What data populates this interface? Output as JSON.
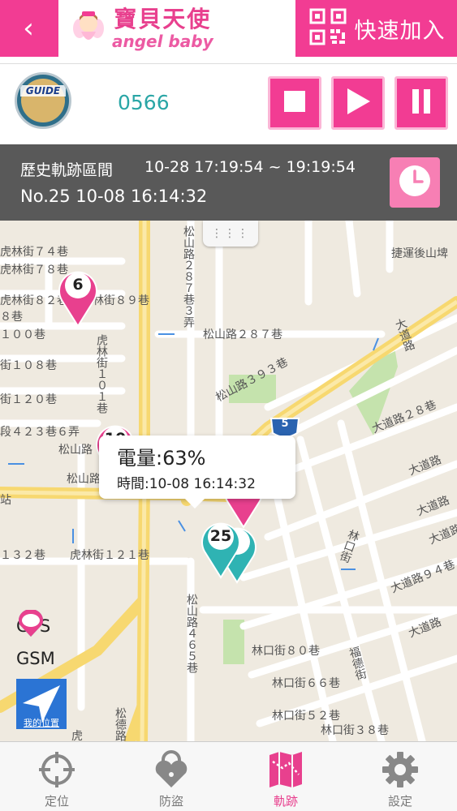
{
  "header": {
    "back_icon": "chevron-left-icon",
    "brand_cn": "寶貝天使",
    "brand_en": "angel baby",
    "quick_add_label": "快速加入",
    "quick_add_icon": "qr-code-icon",
    "accent_color": "#f23c93"
  },
  "device": {
    "logo_text": "GUIDE",
    "id": "0566",
    "controls": [
      "stop-icon",
      "play-icon",
      "pause-icon"
    ]
  },
  "history": {
    "title": "歷史軌跡區間",
    "range": "10-28 17:19:54 ~ 19:19:54",
    "record": "No.25 10-08 16:14:32",
    "clock_icon": "clock-icon"
  },
  "map": {
    "streets": [
      "虎林街７４巷",
      "虎林街７８巷",
      "虎林街８２巷",
      "８巷",
      "虎林街８９巷",
      "１００巷",
      "街１０８巷",
      "街１２０巷",
      "段４２３巷６弄",
      "松山路",
      "松山路",
      "站",
      "１３２巷",
      "虎林街１２１巷",
      "松山路２８７巷",
      "松山路３９３巷",
      "捷運後山埤",
      "大道路",
      "大道路２８巷",
      "大道路",
      "大道路",
      "大道路",
      "大道路９４巷",
      "大道路",
      "林口街８０巷",
      "林口街６６巷",
      "林口街５２巷",
      "林口街３８巷",
      "林口街",
      "福德街",
      "松山路４６５巷",
      "松德路",
      "虎林街１０１巷",
      "松山路２８７巷３弄",
      "虎"
    ],
    "highway_shield": "5",
    "pins": [
      {
        "label": "6",
        "kind": "GSM"
      },
      {
        "label": "10",
        "kind": "GSM"
      },
      {
        "label": "",
        "kind": "GSM"
      },
      {
        "label": "25",
        "kind": "GPS"
      },
      {
        "label": "",
        "kind": "GPS"
      }
    ],
    "popup": {
      "battery": "電量:63%",
      "time": "時間:10-08 16:14:32"
    },
    "legend": [
      {
        "label": "GPS",
        "color": "#2fb3b3"
      },
      {
        "label": "GSM",
        "color": "#e8408e"
      }
    ],
    "nav_button_label": "我的位置"
  },
  "tabs": [
    {
      "label": "定位",
      "icon": "crosshair-icon",
      "active": false
    },
    {
      "label": "防盜",
      "icon": "lock-heart-icon",
      "active": false
    },
    {
      "label": "軌跡",
      "icon": "track-map-icon",
      "active": true
    },
    {
      "label": "設定",
      "icon": "gear-icon",
      "active": false
    }
  ]
}
